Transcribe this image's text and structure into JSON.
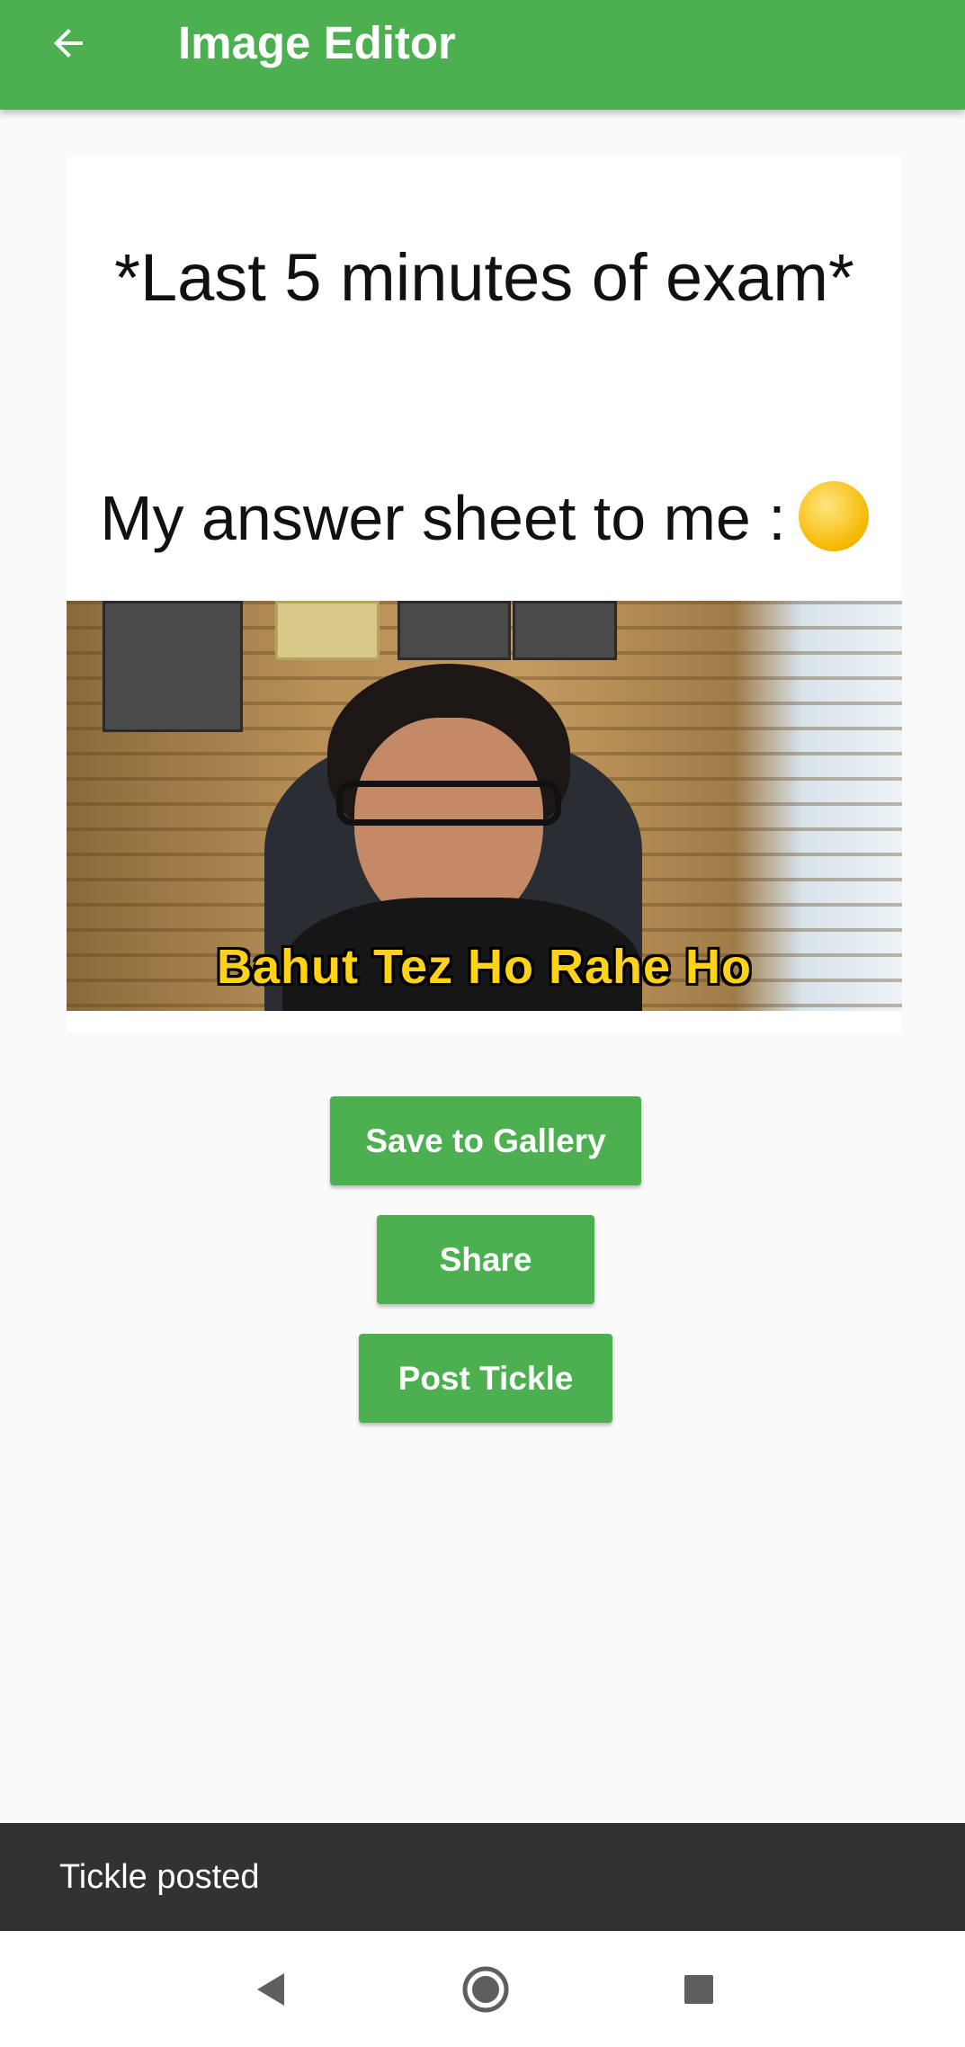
{
  "appbar": {
    "title": "Image Editor",
    "back_icon": "arrow-left-icon",
    "color": "#4caf50"
  },
  "meme": {
    "line1": "*Last 5 minutes of exam*",
    "line2": "My answer sheet to me :",
    "emoji": "smirking-face-emoji",
    "caption": "Bahut Tez Ho Rahe Ho"
  },
  "actions": {
    "save_label": "Save to Gallery",
    "share_label": "Share",
    "post_label": "Post Tickle"
  },
  "snackbar": {
    "message": "Tickle posted"
  },
  "navbar": {
    "back_icon": "nav-back-icon",
    "home_icon": "nav-home-icon",
    "recents_icon": "nav-recents-icon"
  }
}
